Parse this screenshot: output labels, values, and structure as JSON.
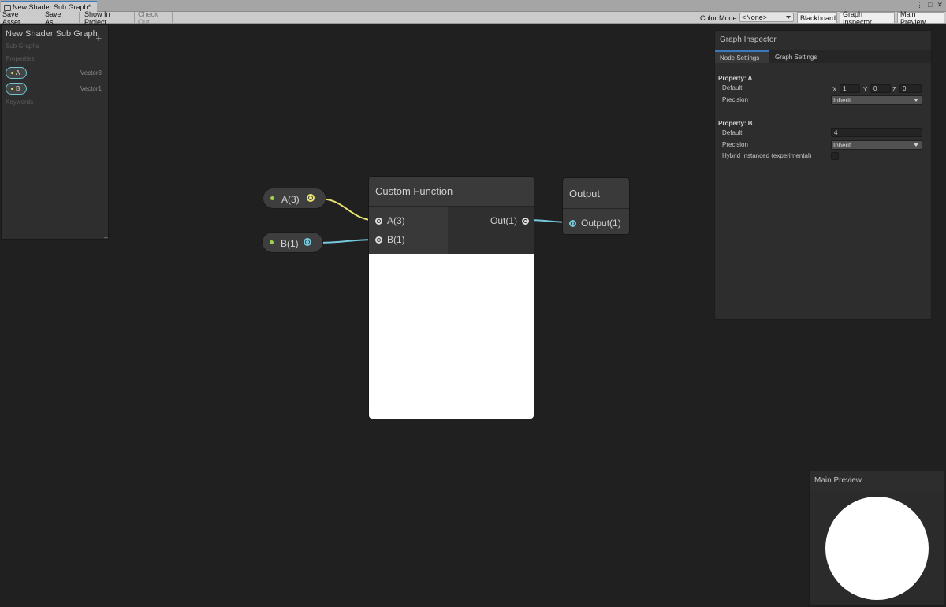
{
  "window": {
    "tab_title": "New Shader Sub Graph*",
    "controls": [
      "⋮",
      "□",
      "✕"
    ]
  },
  "toolbar": {
    "save_asset": "Save Asset",
    "save_as": "Save As...",
    "show_in_project": "Show In Project",
    "check_out": "Check Out",
    "color_mode_label": "Color Mode",
    "color_mode_value": "<None>",
    "blackboard": "Blackboard",
    "graph_inspector": "Graph Inspector",
    "main_preview": "Main Preview"
  },
  "blackboard": {
    "title": "New Shader Sub Graph",
    "subtitle": "Sub Graphs",
    "add": "+",
    "properties_label": "Properties",
    "keywords_label": "Keywords",
    "properties": [
      {
        "name": "A",
        "type": "Vector3"
      },
      {
        "name": "B",
        "type": "Vector1"
      }
    ],
    "resize_glyph": "–"
  },
  "graph": {
    "property_nodes": [
      {
        "label": "A(3)",
        "port_color": "#e8e56f"
      },
      {
        "label": "B(1)",
        "port_color": "#75c9dc"
      }
    ],
    "custom_function": {
      "title": "Custom Function",
      "inputs": [
        "A(3)",
        "B(1)"
      ],
      "output": "Out(1)"
    },
    "output_node": {
      "title": "Output",
      "input": "Output(1)"
    },
    "edge_colors": {
      "vector3": "#e8e56f",
      "vector1": "#75c9dc"
    }
  },
  "inspector": {
    "title": "Graph Inspector",
    "tabs": [
      "Node Settings",
      "Graph Settings"
    ],
    "property_a": {
      "heading": "Property: A",
      "default_label": "Default",
      "x_label": "X",
      "x": "1",
      "y_label": "Y",
      "y": "0",
      "z_label": "Z",
      "z": "0",
      "precision_label": "Precision",
      "precision": "Inherit"
    },
    "property_b": {
      "heading": "Property: B",
      "default_label": "Default",
      "default": "4",
      "precision_label": "Precision",
      "precision": "Inherit",
      "hybrid_label": "Hybrid Instanced (experimental)"
    }
  },
  "main_preview": {
    "title": "Main Preview"
  }
}
